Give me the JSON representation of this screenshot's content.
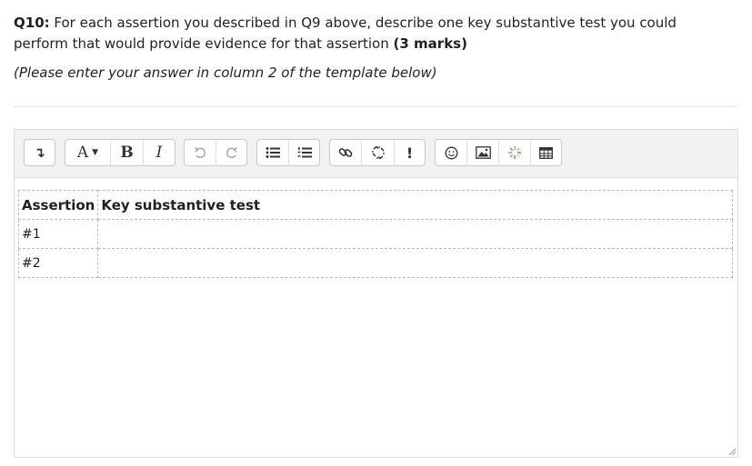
{
  "question": {
    "number": "Q10:",
    "text": "For each assertion you described in Q9 above, describe one key substantive test you could perform that would provide evidence for that assertion",
    "marks": "(3 marks)"
  },
  "hint": "(Please enter your answer in column 2 of the template below)",
  "toolbar": {
    "collapse_icon": "↴",
    "font_label": "A",
    "bold_label": "B",
    "italic_label": "I",
    "accessibility_label": "!"
  },
  "template_table": {
    "headers": [
      "Assertion",
      "Key substantive test"
    ],
    "rows": [
      {
        "assertion": "#1",
        "test": ""
      },
      {
        "assertion": "#2",
        "test": ""
      }
    ]
  }
}
